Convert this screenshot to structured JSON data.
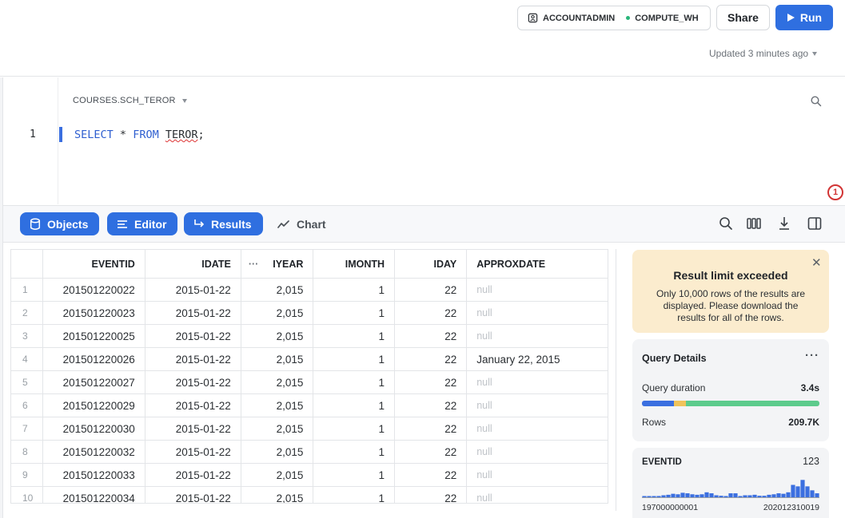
{
  "header": {
    "role": "ACCOUNTADMIN",
    "warehouse": "COMPUTE_WH",
    "share_label": "Share",
    "run_label": "Run",
    "updated_text": "Updated 3 minutes ago",
    "warehouse_status_color": "#29b57a",
    "accent_color": "#2f6fe0"
  },
  "editor": {
    "schema": "COURSES.SCH_TEROR",
    "line_number": "1",
    "sql_keyword_select": "SELECT",
    "sql_star": "*",
    "sql_keyword_from": "FROM",
    "sql_table": "TEROR",
    "sql_end": ";",
    "error_count": "1"
  },
  "toolbar": {
    "objects_label": "Objects",
    "editor_label": "Editor",
    "results_label": "Results",
    "chart_label": "Chart"
  },
  "table": {
    "columns": [
      "EVENTID",
      "IDATE",
      "IYEAR",
      "IMONTH",
      "IDAY",
      "APPROXDATE"
    ],
    "rows": [
      [
        "1",
        "201501220022",
        "2015-01-22",
        "2,015",
        "1",
        "22",
        "null"
      ],
      [
        "2",
        "201501220023",
        "2015-01-22",
        "2,015",
        "1",
        "22",
        "null"
      ],
      [
        "3",
        "201501220025",
        "2015-01-22",
        "2,015",
        "1",
        "22",
        "null"
      ],
      [
        "4",
        "201501220026",
        "2015-01-22",
        "2,015",
        "1",
        "22",
        "January 22, 2015"
      ],
      [
        "5",
        "201501220027",
        "2015-01-22",
        "2,015",
        "1",
        "22",
        "null"
      ],
      [
        "6",
        "201501220029",
        "2015-01-22",
        "2,015",
        "1",
        "22",
        "null"
      ],
      [
        "7",
        "201501220030",
        "2015-01-22",
        "2,015",
        "1",
        "22",
        "null"
      ],
      [
        "8",
        "201501220032",
        "2015-01-22",
        "2,015",
        "1",
        "22",
        "null"
      ],
      [
        "9",
        "201501220033",
        "2015-01-22",
        "2,015",
        "1",
        "22",
        "null"
      ],
      [
        "10",
        "201501220034",
        "2015-01-22",
        "2,015",
        "1",
        "22",
        "null"
      ]
    ]
  },
  "panel": {
    "warning_title": "Result limit exceeded",
    "warning_body": "Only 10,000 rows of the results are displayed. Please download the results for all of the rows.",
    "query_details_title": "Query Details",
    "duration_label": "Query duration",
    "duration_value": "3.4s",
    "duration_segments": [
      {
        "share": 0.18,
        "color": "#3b6fe0"
      },
      {
        "share": 0.07,
        "color": "#f0c35a"
      },
      {
        "share": 0.75,
        "color": "#5ccb8c"
      }
    ],
    "rows_label": "Rows",
    "rows_value": "209.7K",
    "column_name": "EVENTID",
    "column_distinct": "123",
    "column_min": "197000000001",
    "column_max": "202012310019",
    "histogram": [
      0.04,
      0.04,
      0.04,
      0.05,
      0.08,
      0.1,
      0.14,
      0.12,
      0.18,
      0.16,
      0.12,
      0.1,
      0.12,
      0.2,
      0.16,
      0.08,
      0.06,
      0.04,
      0.16,
      0.16,
      0.04,
      0.08,
      0.08,
      0.1,
      0.06,
      0.06,
      0.1,
      0.12,
      0.16,
      0.14,
      0.2,
      0.5,
      0.44,
      0.7,
      0.44,
      0.28,
      0.16
    ]
  }
}
